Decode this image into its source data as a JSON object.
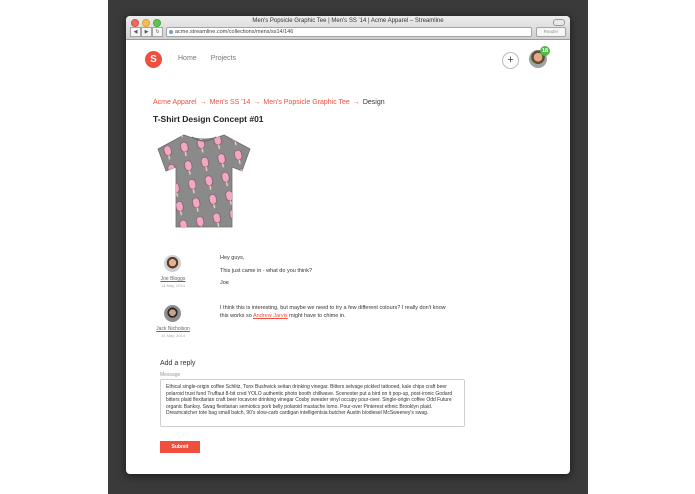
{
  "window": {
    "title": "Men's Popsicle Graphic Tee | Men's SS '14 | Acme Apparel – Streamline",
    "url": "acme.streamline.com/collections/mens/ss14/146",
    "reader_label": "Reader"
  },
  "nav": {
    "logo_letter": "S",
    "items": [
      "Home",
      "Projects"
    ],
    "notification_count": "18"
  },
  "breadcrumb": [
    {
      "label": "Acme Apparel"
    },
    {
      "label": "Men's SS '14"
    },
    {
      "label": "Men's Popsicle Graphic Tee"
    },
    {
      "label": "Design"
    }
  ],
  "breadcrumb_separator": "→",
  "page_title": "T-Shirt Design Concept #01",
  "product": {
    "shirt_color": "#8a8a8a",
    "print_color": "#f2a7c3"
  },
  "comments": [
    {
      "author": "Joe Bloggs",
      "date": "14 May, 2014",
      "lines": [
        "Hey guys,",
        "This just came in - what do you think?",
        "Joe"
      ]
    },
    {
      "author": "Jack Nicholson",
      "date": "14 May, 2014",
      "text_before": "I think this is interesting, but maybe we need to try a few different colours? I really don't know this works so ",
      "mention": "Andrew Jarvis",
      "text_after": " might have to chime in."
    }
  ],
  "reply": {
    "heading": "Add a reply",
    "message_label": "Message",
    "message_text": "Ethical single-origin coffee Schlitz, Tonx Bushwick seitan drinking vinegar. Bitters selvage pickled tattooed, kale chips craft beer polaroid trust fund Truffaut 8-bit cred YOLO authentic photo booth chillwave. Scenester put a bird on it pop-up, post-ironic Godard bitters plaid flexitarian craft beer locavore drinking vinegar Cosby sweater vinyl occupy pour-over. Single-origin coffee Odd Future organic Banksy. Swag flexitarian semiotics pork belly polaroid mustache lomo. Pour-over Pinterest ethnic Brooklyn plaid. Dreamcatcher tote bag small batch, 90's slow-carb cardigan intelligentsia butcher Austin biodiesel McSweeney's swag.",
    "submit_label": "Submit"
  },
  "colors": {
    "accent": "#f04e3e",
    "backdrop": "#3a3a3a"
  }
}
